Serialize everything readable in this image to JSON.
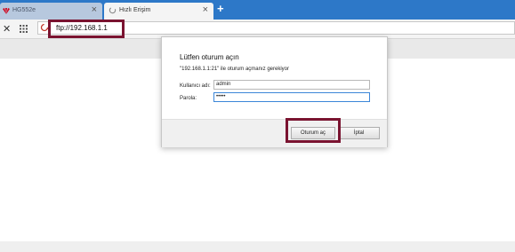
{
  "tabs": [
    {
      "label": "HG552e",
      "active": false,
      "icon": "huawei-icon"
    },
    {
      "label": "Hızlı Erişim",
      "active": true,
      "icon": "loading-spinner-icon"
    }
  ],
  "newtab": "+",
  "toolbar": {
    "close_symbol": "✕",
    "address": "ftp://192.168.1.1"
  },
  "dialog": {
    "title": "Lütfen oturum açın",
    "message": "\"192.168.1.1:21\" ile oturum açmanız gerekiyor",
    "username_label": "Kullanıcı adı:",
    "username_value": "admin",
    "password_label": "Parola:",
    "password_value": "•••••",
    "login_button": "Oturum aç",
    "cancel_button": "İptal"
  },
  "colors": {
    "tabstrip": "#2d78c8",
    "highlight": "#7a1330",
    "focus": "#3c86d8"
  }
}
